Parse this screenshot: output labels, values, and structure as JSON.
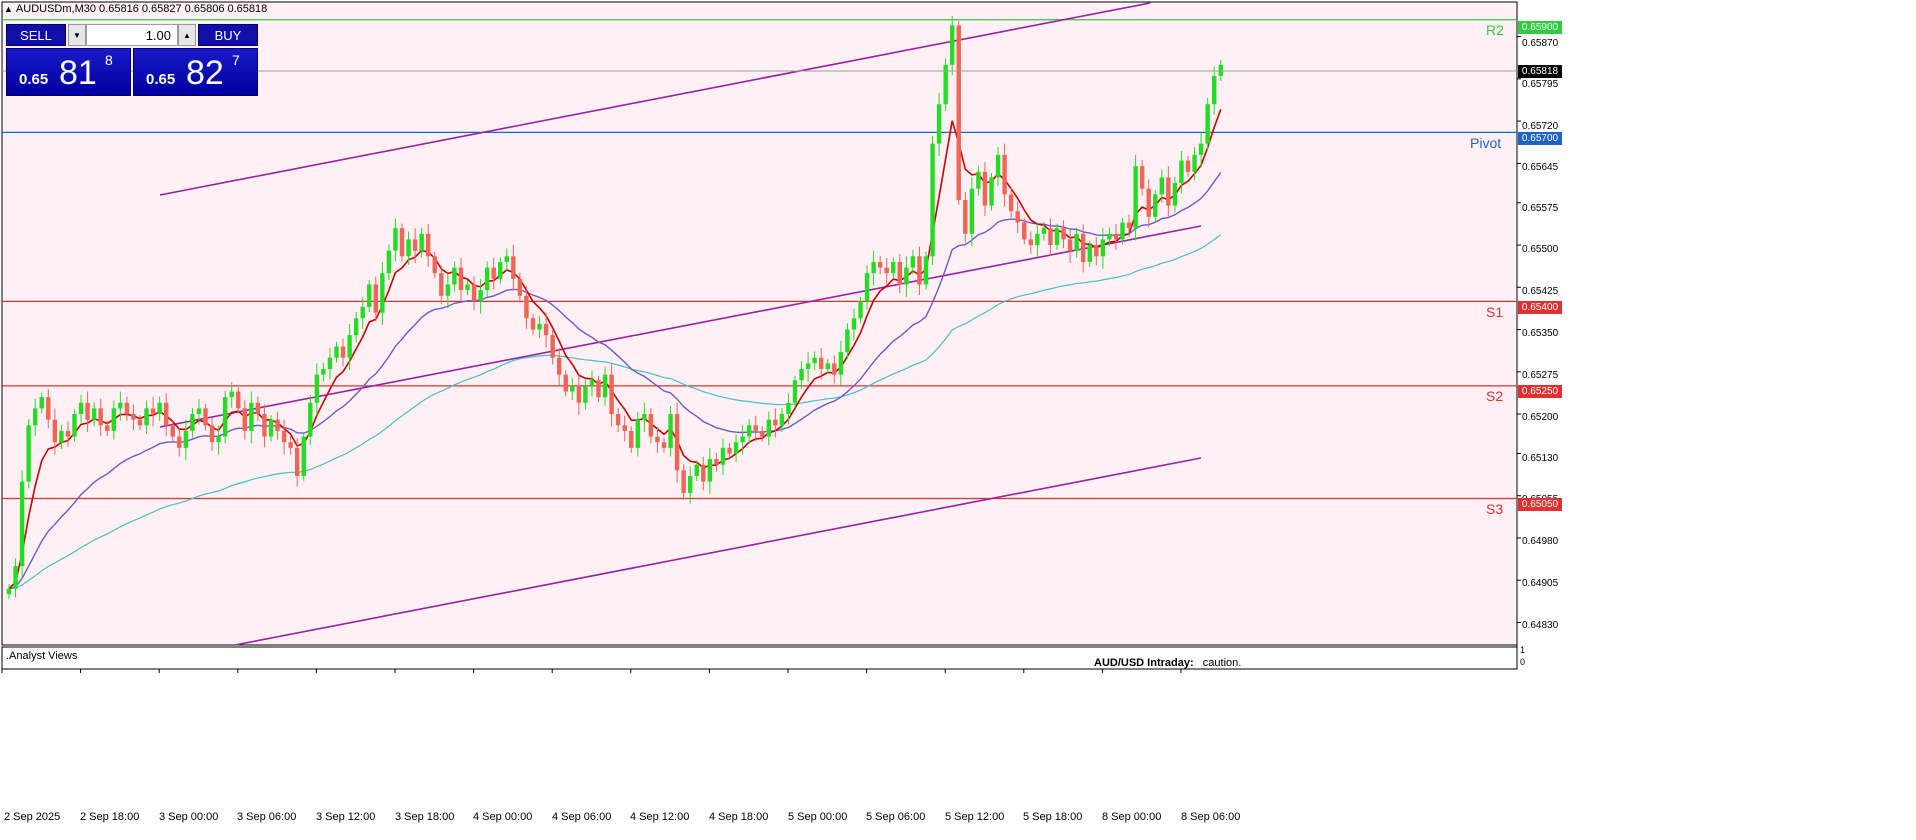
{
  "header": {
    "symbol_info": "AUDUSDm,M30  0.65816 0.65827 0.65806 0.65818"
  },
  "trade_panel": {
    "sell_label": "SELL",
    "buy_label": "BUY",
    "lot": "1.00",
    "sell_price_small": "0.65",
    "sell_price_big": "81",
    "sell_price_sup": "8",
    "buy_price_small": "0.65",
    "buy_price_big": "82",
    "buy_price_sup": "7"
  },
  "price_axis": {
    "ticks": [
      "0.65870",
      "0.65795",
      "0.65720",
      "0.65645",
      "0.65575",
      "0.65500",
      "0.65425",
      "0.65350",
      "0.65275",
      "0.65200",
      "0.65130",
      "0.65055",
      "0.64980",
      "0.64905",
      "0.64830"
    ],
    "current_price": "0.65818"
  },
  "levels": [
    {
      "name": "R2",
      "value": "0.65900",
      "price": 0.659,
      "color": "#2ecc40"
    },
    {
      "name": "Pivot",
      "value": "0.65700",
      "price": 0.657,
      "color": "#1e64c8"
    },
    {
      "name": "S1",
      "value": "0.65400",
      "price": 0.654,
      "color": "#e03030"
    },
    {
      "name": "S2",
      "value": "0.65250",
      "price": 0.6525,
      "color": "#e03030"
    },
    {
      "name": "S3",
      "value": "0.65050",
      "price": 0.6505,
      "color": "#e03030"
    }
  ],
  "time_axis": [
    "2 Sep 2025",
    "2 Sep 18:00",
    "3 Sep 00:00",
    "3 Sep 06:00",
    "3 Sep 12:00",
    "3 Sep 18:00",
    "4 Sep 00:00",
    "4 Sep 06:00",
    "4 Sep 12:00",
    "4 Sep 18:00",
    "5 Sep 00:00",
    "5 Sep 06:00",
    "5 Sep 12:00",
    "5 Sep 18:00",
    "8 Sep 00:00",
    "8 Sep 06:00"
  ],
  "indicator": {
    "name": ".Analyst Views",
    "text_bold": "AUD/USD Intraday:",
    "text": "caution.",
    "axis_top": "1",
    "axis_bottom": "0"
  },
  "colors": {
    "background": "#fff0f5",
    "bull": "#22dd22",
    "bear": "#ee6655",
    "ma_fast": "#cc0000",
    "ma_mid": "#6a5acd",
    "ma_slow": "#48c0c0",
    "channel": "#9b1fa8"
  },
  "chart_data": {
    "type": "candlestick",
    "symbol": "AUDUSDm",
    "timeframe": "M30",
    "ylim": [
      0.6479,
      0.65935
    ],
    "x_labels": [
      "2 Sep 2025",
      "2 Sep 18:00",
      "3 Sep 00:00",
      "3 Sep 06:00",
      "3 Sep 12:00",
      "3 Sep 18:00",
      "4 Sep 00:00",
      "4 Sep 06:00",
      "4 Sep 12:00",
      "4 Sep 18:00",
      "5 Sep 00:00",
      "5 Sep 06:00",
      "5 Sep 12:00",
      "5 Sep 18:00",
      "8 Sep 00:00",
      "8 Sep 06:00"
    ],
    "close": [
      0.6489,
      0.6493,
      0.6508,
      0.6518,
      0.6521,
      0.6523,
      0.6519,
      0.6515,
      0.6517,
      0.6516,
      0.652,
      0.6522,
      0.6519,
      0.6521,
      0.6518,
      0.6517,
      0.6521,
      0.6522,
      0.652,
      0.6519,
      0.6518,
      0.6521,
      0.652,
      0.6522,
      0.6518,
      0.6516,
      0.6514,
      0.6517,
      0.652,
      0.6521,
      0.6518,
      0.6515,
      0.6516,
      0.6523,
      0.6524,
      0.6521,
      0.6517,
      0.6522,
      0.652,
      0.6516,
      0.6519,
      0.6517,
      0.6515,
      0.6514,
      0.6509,
      0.6516,
      0.6522,
      0.6527,
      0.6528,
      0.653,
      0.6532,
      0.653,
      0.6534,
      0.6537,
      0.6539,
      0.6543,
      0.6538,
      0.6545,
      0.6549,
      0.6553,
      0.6548,
      0.6551,
      0.6549,
      0.6552,
      0.6548,
      0.6545,
      0.6541,
      0.6543,
      0.6546,
      0.6542,
      0.6543,
      0.654,
      0.6542,
      0.6546,
      0.6544,
      0.6547,
      0.6548,
      0.6544,
      0.6541,
      0.6537,
      0.6535,
      0.6536,
      0.6534,
      0.653,
      0.6527,
      0.6524,
      0.6525,
      0.6522,
      0.6525,
      0.6526,
      0.6523,
      0.6527,
      0.652,
      0.6518,
      0.6517,
      0.6514,
      0.6519,
      0.652,
      0.6516,
      0.6515,
      0.6514,
      0.652,
      0.651,
      0.6506,
      0.6509,
      0.6511,
      0.6508,
      0.6512,
      0.6511,
      0.6514,
      0.6513,
      0.6515,
      0.6516,
      0.6518,
      0.6517,
      0.6516,
      0.6519,
      0.6518,
      0.652,
      0.6522,
      0.6526,
      0.6528,
      0.6529,
      0.653,
      0.6528,
      0.6529,
      0.6527,
      0.6531,
      0.6535,
      0.6537,
      0.654,
      0.6545,
      0.6547,
      0.6546,
      0.6545,
      0.6547,
      0.6543,
      0.6546,
      0.6548,
      0.6543,
      0.6548,
      0.6568,
      0.6575,
      0.6582,
      0.6589,
      0.6558,
      0.6552,
      0.656,
      0.6563,
      0.6557,
      0.6562,
      0.6566,
      0.6559,
      0.6556,
      0.6554,
      0.6551,
      0.655,
      0.6552,
      0.6553,
      0.655,
      0.6553,
      0.6551,
      0.6549,
      0.6552,
      0.6547,
      0.655,
      0.6548,
      0.6551,
      0.6552,
      0.6551,
      0.6554,
      0.6553,
      0.6564,
      0.656,
      0.6555,
      0.6559,
      0.6562,
      0.6557,
      0.6561,
      0.6565,
      0.6563,
      0.6566,
      0.6568,
      0.6575,
      0.658,
      0.6582
    ],
    "series": [
      {
        "name": "MA fast",
        "color": "#cc0000"
      },
      {
        "name": "MA mid",
        "color": "#6a5acd"
      },
      {
        "name": "MA slow",
        "color": "#48c0c0"
      }
    ],
    "price_levels": {
      "R2": 0.659,
      "Pivot": 0.657,
      "S1": 0.654,
      "S2": 0.6525,
      "S3": 0.6505
    },
    "current_price": 0.65818,
    "grid": false
  }
}
